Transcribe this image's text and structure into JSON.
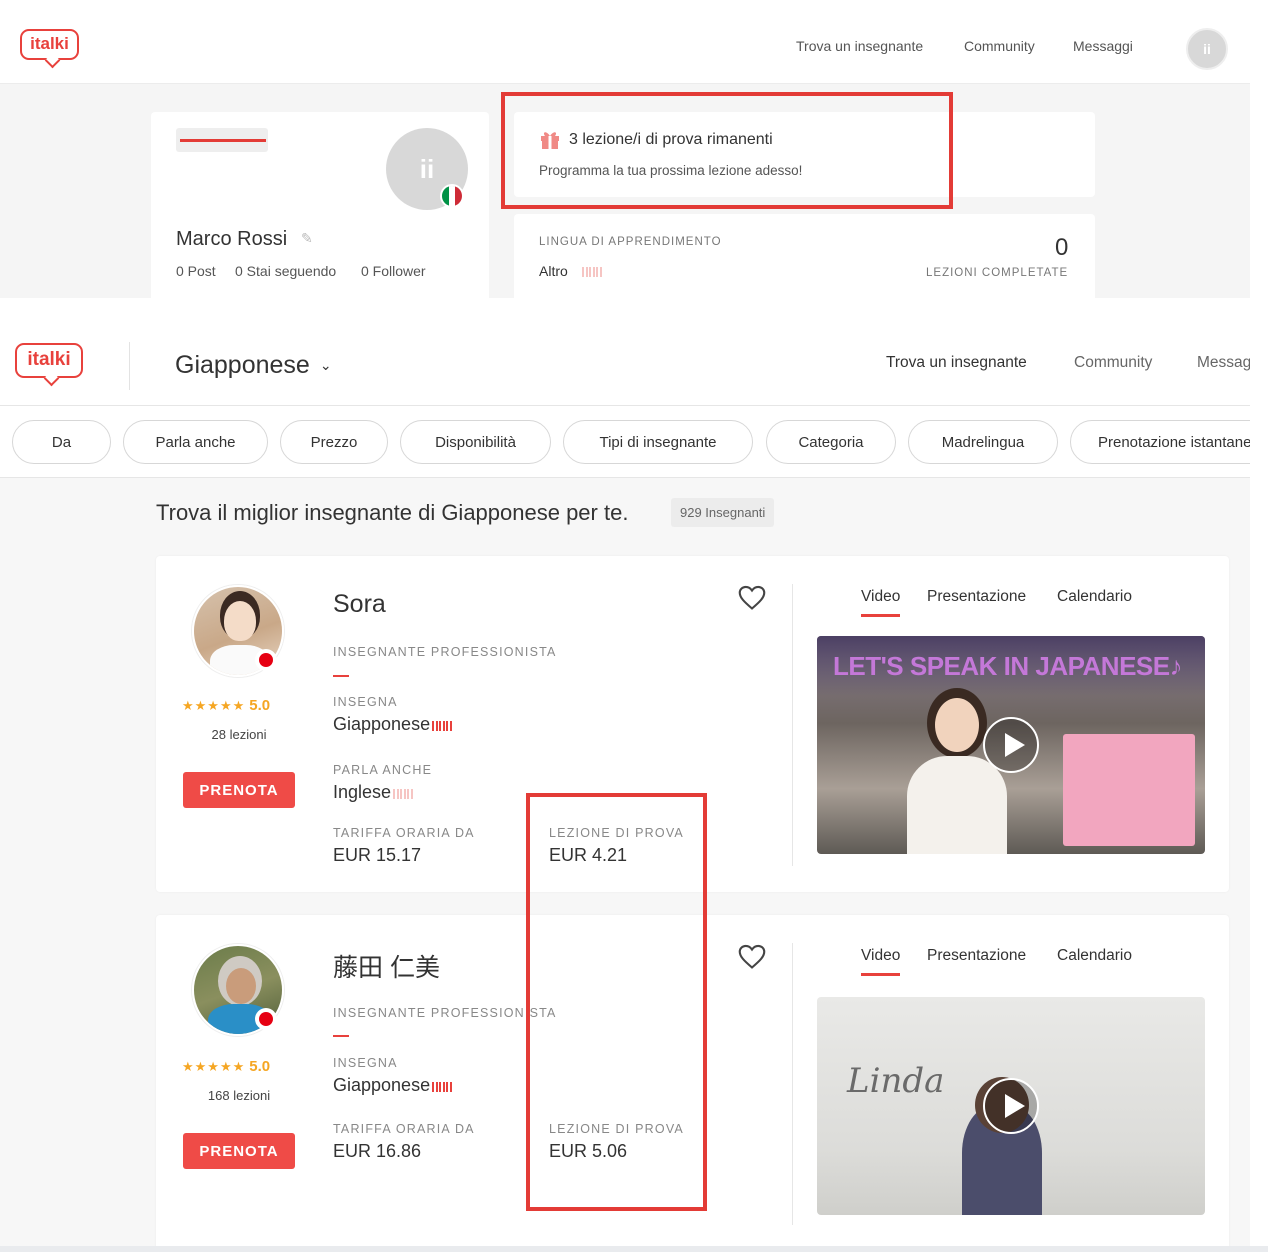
{
  "profile_view": {
    "brand": "italki",
    "nav": [
      "Trova un insegnante",
      "Community",
      "Messaggi"
    ],
    "avatar_initials": "ii",
    "user": {
      "name": "Marco Rossi",
      "stats": {
        "posts": "0 Post",
        "following": "0 Stai seguendo",
        "followers": "0 Follower"
      }
    },
    "trial_banner": {
      "title": "3 lezione/i di prova rimanenti",
      "subtitle": "Programma la tua prossima lezione adesso!"
    },
    "learning": {
      "label": "LINGUA DI APPRENDIMENTO",
      "language": "Altro",
      "completed_count": "0",
      "completed_label": "LEZIONI COMPLETATE"
    }
  },
  "search_view": {
    "brand": "italki",
    "language_selector": "Giapponese",
    "nav": [
      "Trova un insegnante",
      "Community",
      "Messaggi"
    ],
    "filters": [
      "Da",
      "Parla anche",
      "Prezzo",
      "Disponibilità",
      "Tipi di insegnante",
      "Categoria",
      "Madrelingua",
      "Prenotazione istantanea"
    ],
    "heading": "Trova il miglior insegnante di Giapponese per te.",
    "teacher_count": "929 Insegnanti",
    "tabs": [
      "Video",
      "Presentazione",
      "Calendario"
    ],
    "book_label": "PRENOTA",
    "teachers": [
      {
        "name": "Sora",
        "type": "INSEGNANTE PROFESSIONISTA",
        "rating": "5.0",
        "lessons": "28 lezioni",
        "teaches_label": "INSEGNA",
        "teaches": "Giapponese",
        "also_speaks_label": "PARLA ANCHE",
        "also_speaks": "Inglese",
        "rate_label": "TARIFFA ORARIA DA",
        "rate": "EUR 15.17",
        "trial_label": "LEZIONE DI PROVA",
        "trial": "EUR 4.21",
        "video_caption": "LET'S SPEAK IN JAPANESE♪"
      },
      {
        "name": "藤田 仁美",
        "type": "INSEGNANTE PROFESSIONISTA",
        "rating": "5.0",
        "lessons": "168 lezioni",
        "teaches_label": "INSEGNA",
        "teaches": "Giapponese",
        "rate_label": "TARIFFA ORARIA DA",
        "rate": "EUR 16.86",
        "trial_label": "LEZIONE DI PROVA",
        "trial": "EUR 5.06",
        "video_caption": "Linda"
      }
    ]
  },
  "colors": {
    "brand_red": "#e8413c",
    "highlight_red": "#e33b36",
    "star": "#f5a623"
  }
}
